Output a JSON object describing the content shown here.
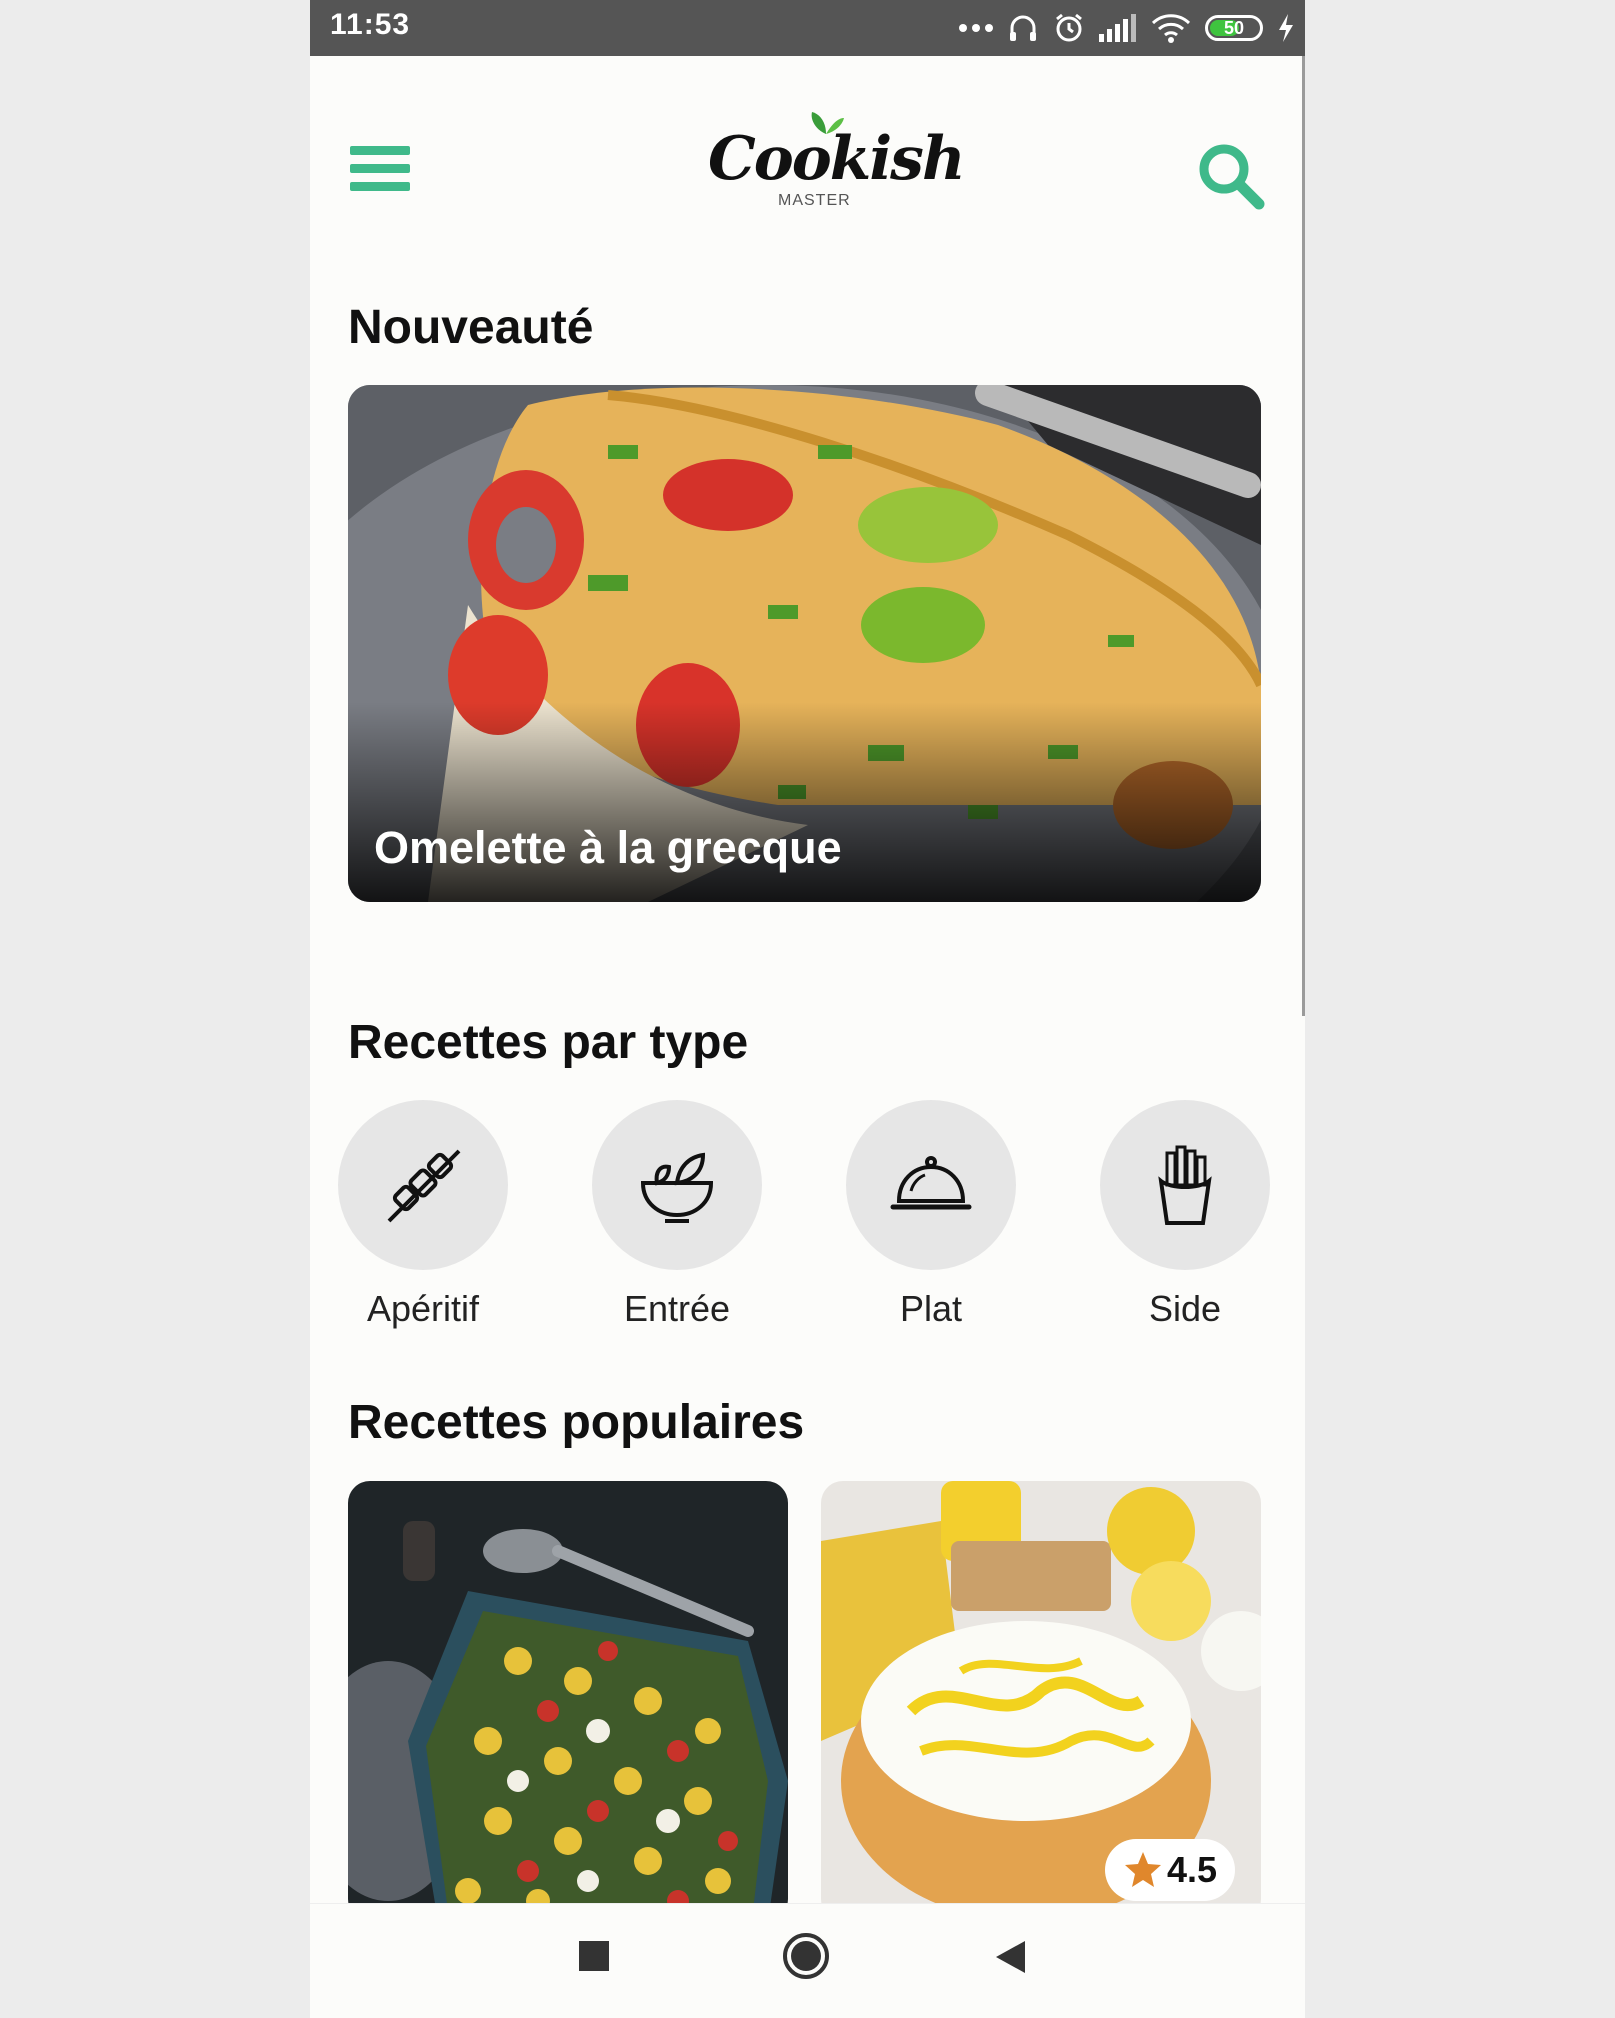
{
  "status_bar": {
    "time": "11:53",
    "battery": "50"
  },
  "header": {
    "logo_text": "Cookish",
    "logo_subtitle": "MASTER",
    "menu_icon": "hamburger-menu-icon",
    "search_icon": "search-icon",
    "accent_color": "#3fb98a"
  },
  "sections": {
    "new": "Nouveauté",
    "types": "Recettes par type",
    "popular": "Recettes populaires"
  },
  "featured": {
    "title": "Omelette à la grecque"
  },
  "recipe_types": [
    {
      "label": "Apéritif",
      "icon": "skewer-icon"
    },
    {
      "label": "Entrée",
      "icon": "salad-bowl-icon"
    },
    {
      "label": "Plat",
      "icon": "cloche-icon"
    },
    {
      "label": "Side",
      "icon": "fries-icon"
    }
  ],
  "popular_recipes": [
    {
      "image": "gnocchi-tray-image"
    },
    {
      "image": "lemon-cake-image",
      "rating": "4.5"
    }
  ],
  "nav": [
    "square-recent-icon",
    "circle-home-icon",
    "triangle-back-icon"
  ]
}
